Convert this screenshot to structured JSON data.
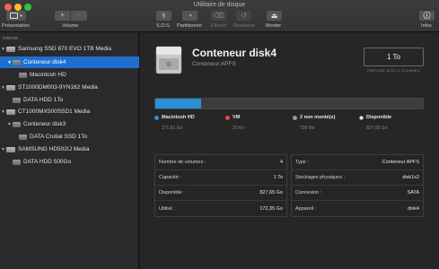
{
  "window": {
    "title": "Utilitaire de disque"
  },
  "toolbar": {
    "view_label": "Présentation",
    "volume_label": "Volume",
    "plus": "+",
    "minus": "−",
    "buttons": [
      {
        "label": "S.O.S.",
        "icon": "stethoscope-icon",
        "enabled": true
      },
      {
        "label": "Partitionner",
        "icon": "partition-icon",
        "enabled": true
      },
      {
        "label": "Effacer",
        "icon": "erase-icon",
        "enabled": false
      },
      {
        "label": "Restaurer",
        "icon": "restore-icon",
        "enabled": false
      },
      {
        "label": "Monter",
        "icon": "mount-icon",
        "enabled": true
      }
    ],
    "info_label": "Infos"
  },
  "sidebar": {
    "header": "Interne",
    "items": [
      {
        "label": "Samsung SSD 870 EVO 1TB Media",
        "level": 0,
        "type": "disk",
        "expanded": true,
        "selected": false
      },
      {
        "label": "Conteneur disk4",
        "level": 1,
        "type": "container",
        "expanded": true,
        "selected": true
      },
      {
        "label": "Macintosh HD",
        "level": 2,
        "type": "volume",
        "selected": false
      },
      {
        "label": "ST1000DM003-9YN162 Media",
        "level": 0,
        "type": "disk",
        "expanded": true,
        "selected": false
      },
      {
        "label": "DATA HDD 1To",
        "level": 1,
        "type": "volume",
        "selected": false
      },
      {
        "label": "CT1000MX500SSD1 Media",
        "level": 0,
        "type": "disk",
        "expanded": true,
        "selected": false
      },
      {
        "label": "Conteneur disk3",
        "level": 1,
        "type": "container",
        "expanded": true,
        "selected": false
      },
      {
        "label": "DATA Crutial  SSD 1To",
        "level": 2,
        "type": "volume",
        "selected": false
      },
      {
        "label": "SAMSUNG HD502IJ Media",
        "level": 0,
        "type": "disk",
        "expanded": true,
        "selected": false
      },
      {
        "label": "DATA HDD 500Go",
        "level": 1,
        "type": "volume",
        "selected": false
      }
    ]
  },
  "main": {
    "title": "Conteneur disk4",
    "subtitle": "Conteneur APFS",
    "size": "1 To",
    "size_caption": "PARTAGÉ AVEC 4 VOLUMES",
    "usage_fraction": 0.17,
    "legend": [
      {
        "name": "Macintosh HD",
        "value": "171,61 Go",
        "color": "#2c8fd6"
      },
      {
        "name": "VM",
        "value": "20 Ko",
        "color": "#e04a3c"
      },
      {
        "name": "2 non monté(s)",
        "value": "739 Mo",
        "color": "#9a9a9a"
      },
      {
        "name": "Disponible",
        "value": "827,65 Go",
        "color": "#ffffff"
      }
    ],
    "left_table": [
      {
        "key": "Nombre de volumes :",
        "value": "4"
      },
      {
        "key": "Capacité :",
        "value": "1 To"
      },
      {
        "key": "Disponible :",
        "value": "827,65 Go"
      },
      {
        "key": "Utilisé :",
        "value": "172,35 Go"
      }
    ],
    "right_table": [
      {
        "key": "Type :",
        "value": "Conteneur APFS"
      },
      {
        "key": "Stockages physiques :",
        "value": "disk1s2"
      },
      {
        "key": "Connexion :",
        "value": "SATA"
      },
      {
        "key": "Appareil :",
        "value": "disk4"
      }
    ]
  },
  "colors": {
    "accent": "#1f6fd1",
    "usage_fill": "#2c8fd6"
  }
}
